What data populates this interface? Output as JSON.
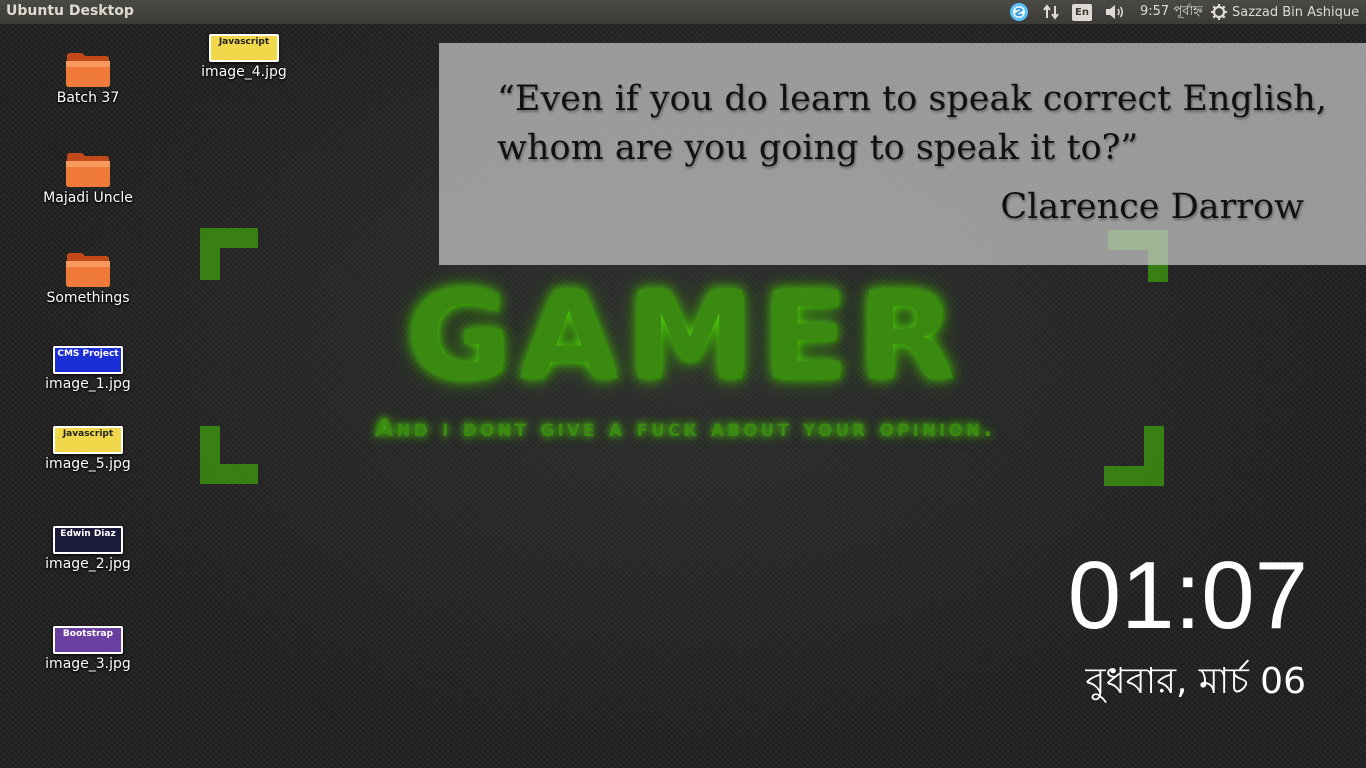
{
  "panel": {
    "app_title": "Ubuntu Desktop",
    "keyboard_layout": "En",
    "clock": "9:57 পূর্বাহ্ন",
    "user": "Sazzad Bin Ashique",
    "bg_color": "#3c3b37",
    "text_color": "#dfdbd2"
  },
  "desktop_items": [
    {
      "label": "Batch 37",
      "icon": "folder-icon"
    },
    {
      "label": "Majadi Uncle",
      "icon": "folder-icon"
    },
    {
      "label": "Somethings",
      "icon": "folder-icon"
    },
    {
      "label": "image_1.jpg",
      "thumb": "CMS Project",
      "thumb_bg": "#1c2fd6",
      "thumb_color": "#ffffff"
    },
    {
      "label": "image_5.jpg",
      "thumb": "Javascript",
      "thumb_bg": "#f0d84a",
      "thumb_color": "#222222"
    },
    {
      "label": "image_2.jpg",
      "thumb": "Edwin Diaz",
      "thumb_bg": "#1b1a3a",
      "thumb_color": "#ffffff"
    },
    {
      "label": "image_3.jpg",
      "thumb": "Bootstrap",
      "thumb_bg": "#6b3fa0",
      "thumb_color": "#ffffff"
    },
    {
      "label": "image_4.jpg",
      "thumb": "Javascript",
      "thumb_bg": "#f0d84a",
      "thumb_color": "#222222"
    }
  ],
  "wallpaper": {
    "headline": "GAMER",
    "tagline": "And i dont give a fuck about your opinion.",
    "accent": "#4fd10e"
  },
  "quote": {
    "text": "“Even if you do learn to speak correct English, whom are you going to speak it to?”",
    "author": "Clarence Darrow"
  },
  "clock_widget": {
    "time": "01:07",
    "date": "বুধবার, মার্চ 06"
  }
}
